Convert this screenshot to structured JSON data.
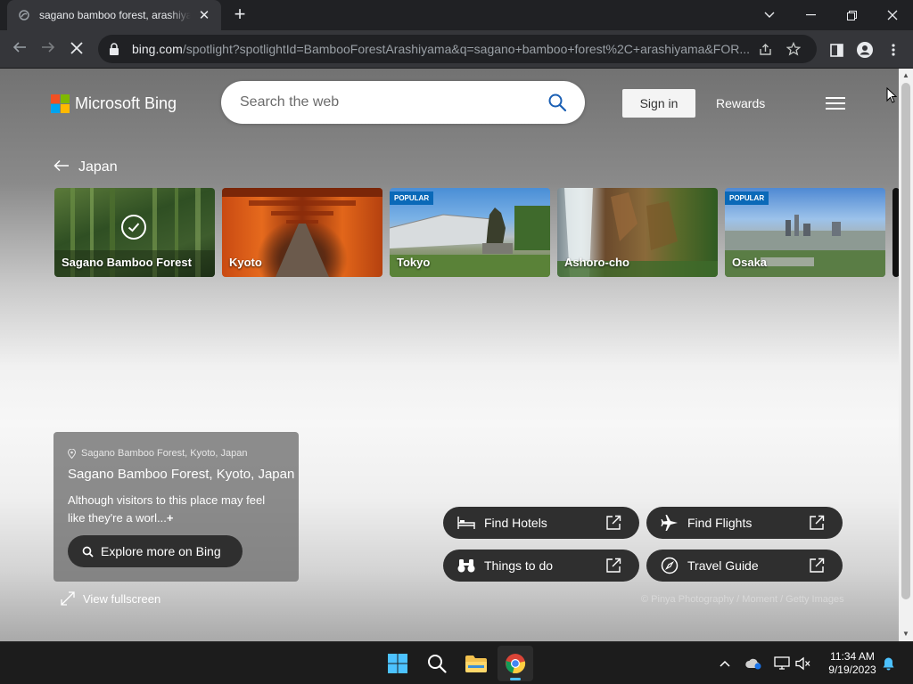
{
  "browser": {
    "tab_title": "sagano bamboo forest, arashiyama",
    "url_host": "bing.com",
    "url_path": "/spotlight?spotlightId=BambooForestArashiyama&q=sagano+bamboo+forest%2C+arashiyama&FOR..."
  },
  "header": {
    "logo_text": "Microsoft Bing",
    "search_placeholder": "Search the web",
    "signin_label": "Sign in",
    "rewards_label": "Rewards"
  },
  "breadcrumb": {
    "label": "Japan"
  },
  "destinations": [
    {
      "name": "Sagano Bamboo Forest",
      "badge": "",
      "selected": true
    },
    {
      "name": "Kyoto",
      "badge": ""
    },
    {
      "name": "Tokyo",
      "badge": "POPULAR"
    },
    {
      "name": "Ashoro-cho",
      "badge": ""
    },
    {
      "name": "Osaka",
      "badge": "POPULAR"
    }
  ],
  "info_card": {
    "location": "Sagano Bamboo Forest, Kyoto, Japan",
    "title": "Sagano Bamboo Forest, Kyoto, Japan",
    "description": "Although visitors to this place may feel like they're a worl...",
    "expand_symbol": "+",
    "explore_label": "Explore more on Bing"
  },
  "view_fullscreen_label": "View fullscreen",
  "actions": [
    {
      "label": "Find Hotels",
      "icon": "bed-icon"
    },
    {
      "label": "Find Flights",
      "icon": "airplane-icon"
    },
    {
      "label": "Things to do",
      "icon": "binoculars-icon"
    },
    {
      "label": "Travel Guide",
      "icon": "compass-icon"
    }
  ],
  "photo_credit": "© Pinya Photography / Moment / Getty Images",
  "taskbar": {
    "time": "11:34 AM",
    "date": "9/19/2023"
  },
  "colors": {
    "ms_red": "#f25022",
    "ms_green": "#7fba00",
    "ms_blue": "#00a4ef",
    "ms_yellow": "#ffb900",
    "badge_blue": "#0a69b8",
    "search_icon_blue": "#1a5fb4"
  }
}
